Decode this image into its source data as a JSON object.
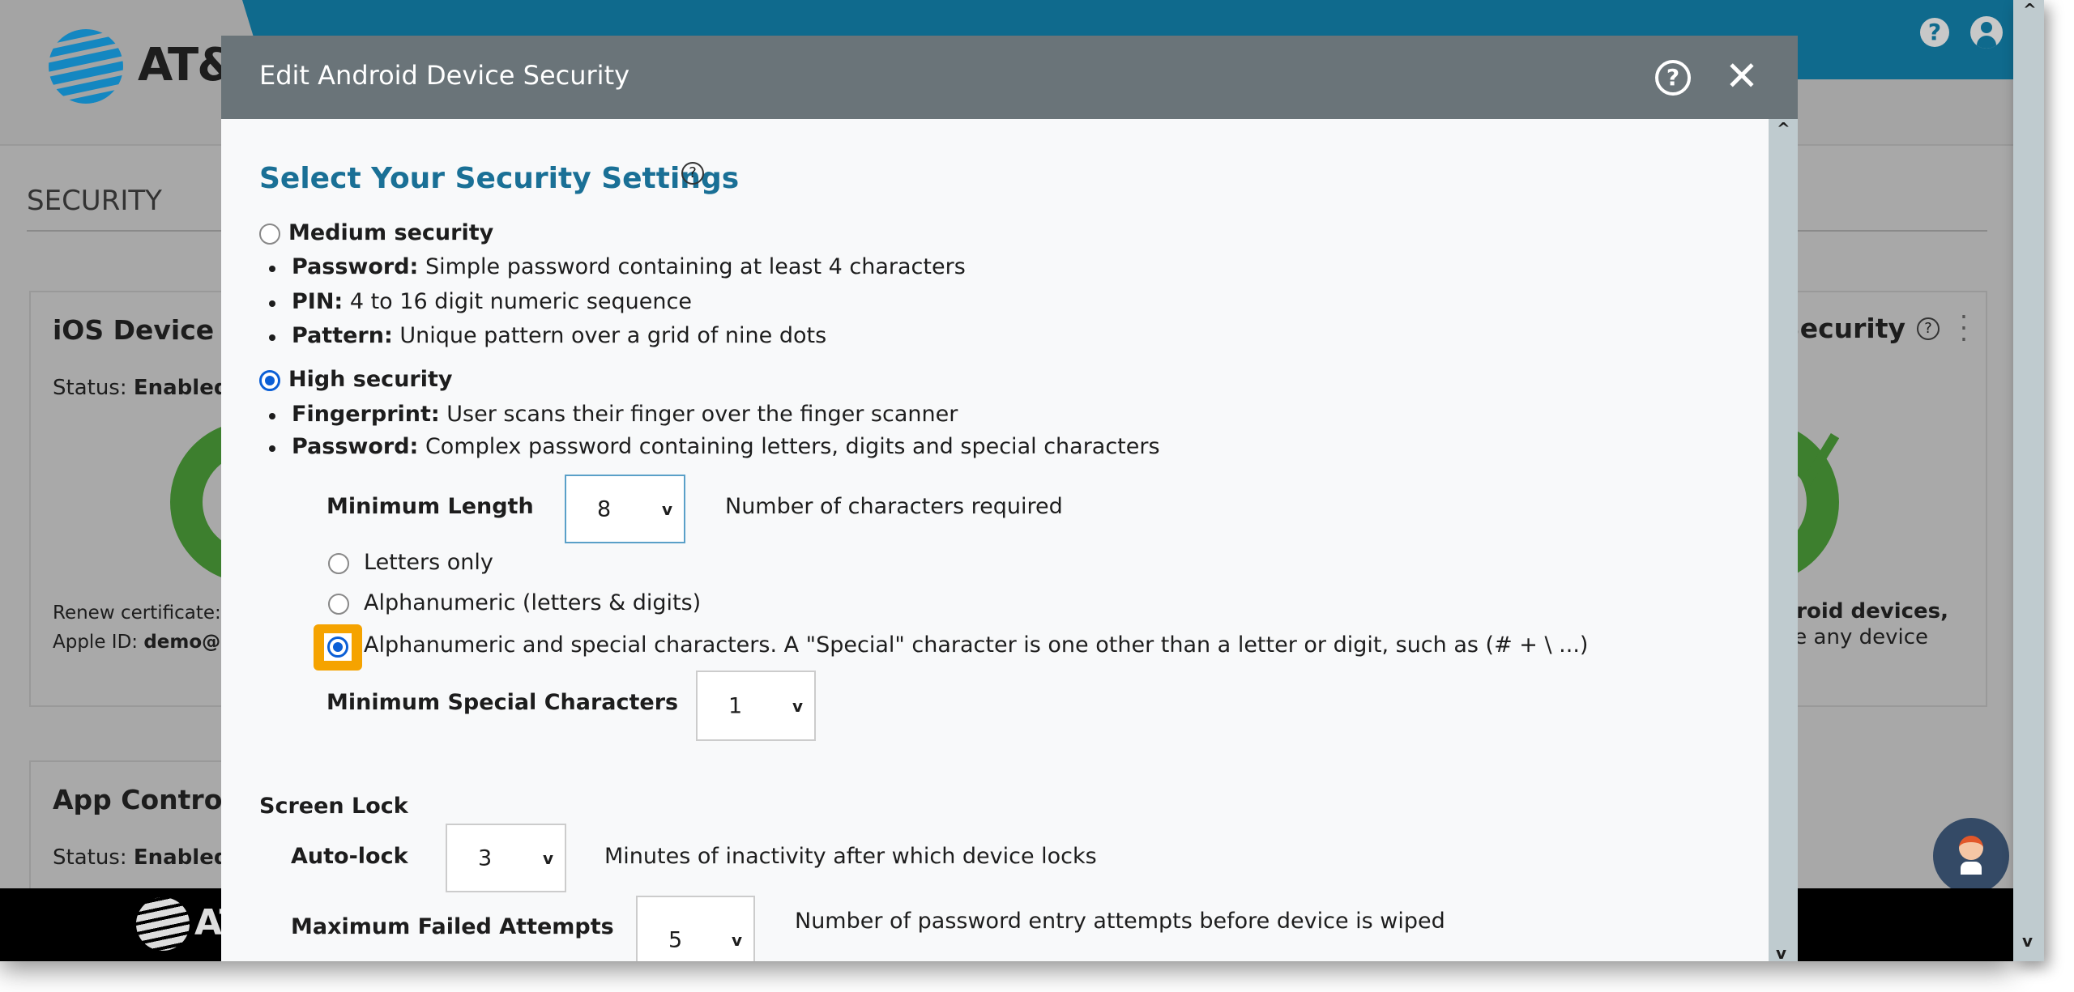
{
  "header": {
    "logo_text": "AT&T",
    "help_icon": "help-circle-icon",
    "user_icon": "user-icon"
  },
  "page": {
    "title": "SECURITY"
  },
  "ios_card": {
    "title": "iOS Device S",
    "status_label": "Status:",
    "status_value": "Enabled",
    "renew_label": "Renew certificate: ",
    "apple_id_label": "Apple ID:",
    "apple_id_value": "demo@i"
  },
  "app_card": {
    "title": "App Control",
    "status_label": "Status:",
    "status_value": "Enabled"
  },
  "android_card": {
    "title": "Security",
    "line1": "droid devices,",
    "line2": "pe any device"
  },
  "footer": {
    "logo_text": "AT"
  },
  "modal": {
    "title": "Edit Android Device Security",
    "heading": "Select Your Security Settings",
    "medium": {
      "label": "Medium security",
      "selected": false,
      "items": [
        {
          "key": "Password:",
          "text": " Simple password containing at least 4 characters"
        },
        {
          "key": "PIN:",
          "text": " 4 to 16 digit numeric sequence"
        },
        {
          "key": "Pattern:",
          "text": " Unique pattern over a grid of nine dots"
        }
      ]
    },
    "high": {
      "label": "High security",
      "selected": true,
      "items": [
        {
          "key": "Fingerprint:",
          "text": " User scans their finger over the finger scanner"
        },
        {
          "key": "Password:",
          "text": " Complex password containing letters, digits and special characters"
        }
      ]
    },
    "min_length": {
      "label": "Minimum Length",
      "value": "8",
      "desc": "Number of characters required"
    },
    "char_options": [
      {
        "label": "Letters only",
        "selected": false
      },
      {
        "label": "Alphanumeric (letters & digits)",
        "selected": false
      },
      {
        "label": "Alphanumeric and special characters. A \"Special\" character is one other than a letter or digit, such as  (# + \\ ...)",
        "selected": true
      }
    ],
    "min_special": {
      "label": "Minimum Special Characters",
      "value": "1"
    },
    "screen_lock": {
      "heading": "Screen Lock",
      "auto_lock": {
        "label": "Auto-lock",
        "value": "3",
        "desc": "Minutes of inactivity after which device locks"
      },
      "max_failed": {
        "label": "Maximum Failed Attempts",
        "value": "5",
        "desc": "Number of password entry attempts before device is wiped"
      }
    }
  },
  "colors": {
    "accent": "#1a7096",
    "header_blue": "#0f6a8d",
    "modal_header": "#6a7479",
    "focus": "#f5a300",
    "primary_button": "#f2c14e"
  }
}
